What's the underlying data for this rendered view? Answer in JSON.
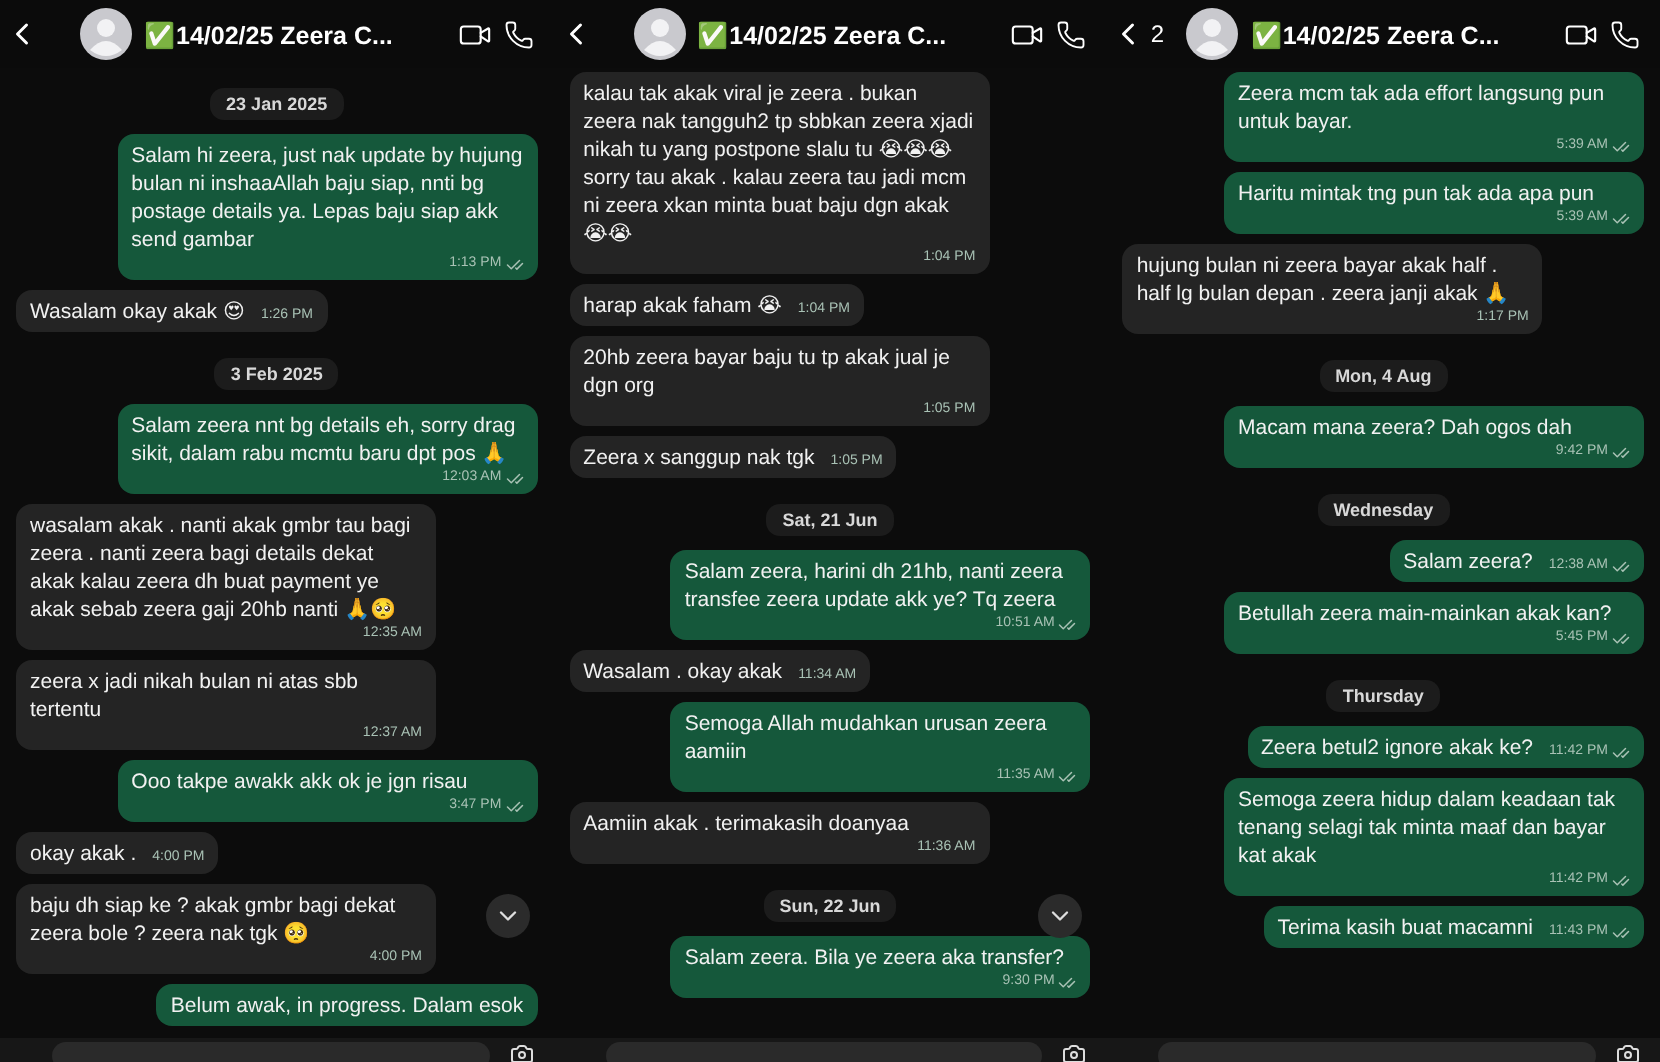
{
  "panels": [
    {
      "header": {
        "title": "✅14/02/25 Zeera C..."
      },
      "scroll_down": true,
      "messages": [
        {
          "kind": "date",
          "text": "23 Jan 2025"
        },
        {
          "kind": "out",
          "text": "Salam hi zeera, just nak update by hujung bulan ni inshaaAllah baju siap, nnti bg postage details ya. Lepas baju siap akk send gambar",
          "time": "1:13 PM"
        },
        {
          "kind": "in",
          "text": "Wasalam okay akak 😍",
          "time": "1:26 PM"
        },
        {
          "kind": "date",
          "text": "3 Feb 2025"
        },
        {
          "kind": "out",
          "text": "Salam zeera nnt bg details eh, sorry drag sikit, dalam rabu mcmtu baru dpt pos 🙏",
          "time": "12:03 AM"
        },
        {
          "kind": "in",
          "text": "wasalam akak . nanti akak gmbr tau bagi zeera . nanti zeera bagi details dekat akak kalau zeera dh buat payment ye akak sebab zeera gaji 20hb nanti 🙏🥺",
          "time": "12:35 AM"
        },
        {
          "kind": "in",
          "text": "zeera x jadi nikah bulan ni atas sbb tertentu",
          "time": "12:37 AM"
        },
        {
          "kind": "out",
          "text": "Ooo takpe awakk akk ok je jgn risau",
          "time": "3:47 PM"
        },
        {
          "kind": "in",
          "text": "okay akak .",
          "time": "4:00 PM"
        },
        {
          "kind": "in",
          "text": "baju dh siap ke ? akak gmbr bagi dekat zeera bole ? zeera nak tgk 🥺",
          "time": "4:00 PM"
        },
        {
          "kind": "out",
          "text": "Belum awak, in progress. Dalam esok"
        }
      ]
    },
    {
      "header": {
        "title": "✅14/02/25 Zeera C..."
      },
      "scroll_down": true,
      "messages": [
        {
          "kind": "in",
          "text": "kalau tak akak viral je zeera . bukan zeera nak tangguh2 tp sbbkan zeera xjadi nikah tu yang postpone slalu tu 😭😭😭 sorry tau akak . kalau zeera tau jadi mcm ni zeera xkan minta buat baju dgn akak 😭😭",
          "time": "1:04 PM"
        },
        {
          "kind": "in",
          "text": "harap akak faham 😭",
          "time": "1:04 PM"
        },
        {
          "kind": "in",
          "text": "20hb zeera bayar baju tu tp akak jual je dgn org",
          "time": "1:05 PM"
        },
        {
          "kind": "in",
          "text": "Zeera x sanggup nak tgk",
          "time": "1:05 PM"
        },
        {
          "kind": "date",
          "text": "Sat, 21 Jun"
        },
        {
          "kind": "out",
          "text": "Salam zeera, harini dh 21hb, nanti zeera transfee zeera update akk ye? Tq zeera",
          "time": "10:51 AM"
        },
        {
          "kind": "in",
          "text": "Wasalam . okay akak",
          "time": "11:34 AM"
        },
        {
          "kind": "out",
          "text": "Semoga Allah mudahkan urusan zeera aamiin",
          "time": "11:35 AM"
        },
        {
          "kind": "in",
          "text": "Aamiin akak . terimakasih doanyaa",
          "time": "11:36 AM"
        },
        {
          "kind": "date",
          "text": "Sun, 22 Jun"
        },
        {
          "kind": "out",
          "text": "Salam zeera. Bila ye zeera aka transfer?",
          "time": "9:30 PM"
        }
      ]
    },
    {
      "header": {
        "title": "✅14/02/25 Zeera C...",
        "unread": "2"
      },
      "messages": [
        {
          "kind": "out",
          "text": "Zeera mcm tak ada effort langsung pun untuk bayar.",
          "time": "5:39 AM"
        },
        {
          "kind": "out",
          "text": "Haritu mintak tng pun tak ada apa pun",
          "time": "5:39 AM"
        },
        {
          "kind": "in",
          "text": "hujung bulan ni zeera bayar akak half . half lg bulan depan . zeera janji akak 🙏",
          "time": "1:17 PM"
        },
        {
          "kind": "date",
          "text": "Mon, 4 Aug"
        },
        {
          "kind": "out",
          "text": "Macam mana zeera? Dah ogos dah",
          "time": "9:42 PM"
        },
        {
          "kind": "date",
          "text": "Wednesday"
        },
        {
          "kind": "out",
          "text": "Salam zeera?",
          "time": "12:38 AM"
        },
        {
          "kind": "out",
          "text": "Betullah zeera main-mainkan akak kan?",
          "time": "5:45 PM"
        },
        {
          "kind": "date",
          "text": "Thursday"
        },
        {
          "kind": "out",
          "text": "Zeera betul2 ignore akak ke?",
          "time": "11:42 PM"
        },
        {
          "kind": "out",
          "text": "Semoga zeera hidup dalam keadaan tak tenang selagi tak minta maaf dan bayar kat akak",
          "time": "11:42 PM"
        },
        {
          "kind": "out",
          "text": "Terima kasih buat macamni",
          "time": "11:43 PM"
        }
      ]
    }
  ]
}
